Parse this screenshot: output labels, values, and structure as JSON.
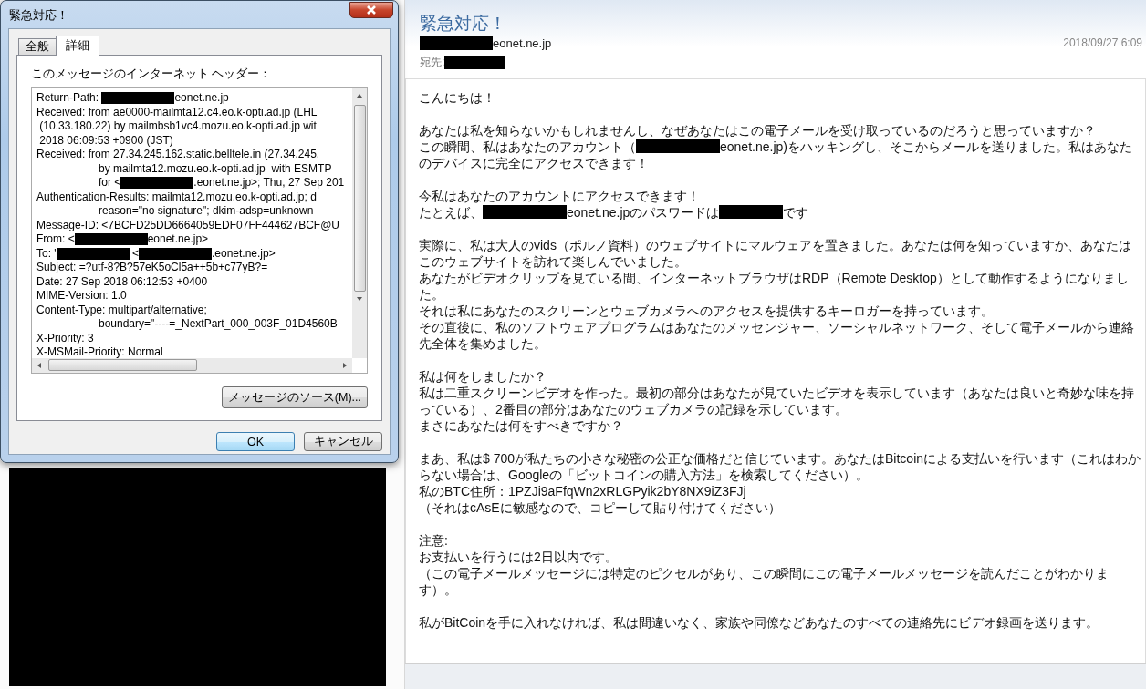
{
  "dialog": {
    "title": "緊急対応！",
    "tabs": [
      {
        "label": "全般",
        "selected": false
      },
      {
        "label": "詳細",
        "selected": true
      }
    ],
    "headers_label": "このメッセージのインターネット ヘッダー：",
    "headers": [
      {
        "indent": false,
        "segments": [
          {
            "kind": "text",
            "text": "Return-Path: "
          },
          {
            "kind": "redacted"
          },
          {
            "kind": "text",
            "text": "eonet.ne.jp"
          }
        ]
      },
      {
        "indent": false,
        "segments": [
          {
            "kind": "text",
            "text": "Received: from ae0000-mailmta12.c4.eo.k-opti.ad.jp (LHL"
          }
        ]
      },
      {
        "indent": false,
        "segments": [
          {
            "kind": "text",
            "text": " (10.33.180.22) by mailmbsb1vc4.mozu.eo.k-opti.ad.jp wit"
          }
        ]
      },
      {
        "indent": false,
        "segments": [
          {
            "kind": "text",
            "text": " 2018 06:09:53 +0900 (JST)"
          }
        ]
      },
      {
        "indent": false,
        "segments": [
          {
            "kind": "text",
            "text": "Received: from 27.34.245.162.static.belltele.in (27.34.245."
          }
        ]
      },
      {
        "indent": true,
        "segments": [
          {
            "kind": "text",
            "text": "by mailmta12.mozu.eo.k-opti.ad.jp  with ESMTP"
          }
        ]
      },
      {
        "indent": true,
        "segments": [
          {
            "kind": "text",
            "text": "for <"
          },
          {
            "kind": "redacted"
          },
          {
            "kind": "text",
            "text": ".eonet.ne.jp>; Thu, 27 Sep 201"
          }
        ]
      },
      {
        "indent": false,
        "segments": [
          {
            "kind": "text",
            "text": "Authentication-Results: mailmta12.mozu.eo.k-opti.ad.jp; d"
          }
        ]
      },
      {
        "indent": true,
        "segments": [
          {
            "kind": "text",
            "text": "reason=\"no signature\"; dkim-adsp=unknown"
          }
        ]
      },
      {
        "indent": false,
        "segments": [
          {
            "kind": "text",
            "text": "Message-ID: <7BCFD25DD6664059EDF07FF444627BCF@U"
          }
        ]
      },
      {
        "indent": false,
        "segments": [
          {
            "kind": "text",
            "text": "From: <"
          },
          {
            "kind": "redacted"
          },
          {
            "kind": "text",
            "text": "eonet.ne.jp>"
          }
        ]
      },
      {
        "indent": false,
        "segments": [
          {
            "kind": "text",
            "text": "To: '"
          },
          {
            "kind": "redacted"
          },
          {
            "kind": "text",
            "text": " <"
          },
          {
            "kind": "redacted"
          },
          {
            "kind": "text",
            "text": ".eonet.ne.jp>"
          }
        ]
      },
      {
        "indent": false,
        "segments": [
          {
            "kind": "text",
            "text": "Subject: =?utf-8?B?57eK5oCl5a++5b+c77yB?="
          }
        ]
      },
      {
        "indent": false,
        "segments": [
          {
            "kind": "text",
            "text": "Date: 27 Sep 2018 06:12:53 +0400"
          }
        ]
      },
      {
        "indent": false,
        "segments": [
          {
            "kind": "text",
            "text": "MIME-Version: 1.0"
          }
        ]
      },
      {
        "indent": false,
        "segments": [
          {
            "kind": "text",
            "text": "Content-Type: multipart/alternative;"
          }
        ]
      },
      {
        "indent": true,
        "segments": [
          {
            "kind": "text",
            "text": "boundary=\"----=_NextPart_000_003F_01D4560B"
          }
        ]
      },
      {
        "indent": false,
        "segments": [
          {
            "kind": "text",
            "text": "X-Priority: 3"
          }
        ]
      },
      {
        "indent": false,
        "segments": [
          {
            "kind": "text",
            "text": "X-MSMail-Priority: Normal"
          }
        ]
      }
    ],
    "source_button": "メッセージのソース(M)...",
    "buttons": [
      {
        "label": "OK",
        "default": true
      },
      {
        "label": "キャンセル",
        "default": false
      }
    ]
  },
  "message": {
    "subject": "緊急対応！",
    "from": [
      {
        "kind": "redacted"
      },
      {
        "kind": "text",
        "text": "eonet.ne.jp"
      }
    ],
    "date": "2018/09/27 6:09",
    "to_label": "宛先:",
    "to": [
      {
        "kind": "redacted"
      }
    ],
    "body": [
      [
        [
          {
            "kind": "text",
            "text": "こんにちは！"
          }
        ]
      ],
      [
        [
          {
            "kind": "text",
            "text": "あなたは私を知らないかもしれませんし、なぜあなたはこの電子メールを受け取っているのだろうと思っていますか？"
          }
        ],
        [
          {
            "kind": "text",
            "text": "この瞬間、私はあなたのアカウント（"
          },
          {
            "kind": "redacted"
          },
          {
            "kind": "text",
            "text": "eonet.ne.jp)をハッキングし、そこからメールを送りました。私はあなたのデバイスに完全にアクセスできます！"
          }
        ]
      ],
      [
        [
          {
            "kind": "text",
            "text": "今私はあなたのアカウントにアクセスできます！"
          }
        ],
        [
          {
            "kind": "text",
            "text": "たとえば、"
          },
          {
            "kind": "redacted"
          },
          {
            "kind": "text",
            "text": "eonet.ne.jpのパスワードは"
          },
          {
            "kind": "redacted"
          },
          {
            "kind": "text",
            "text": "です"
          }
        ]
      ],
      [
        [
          {
            "kind": "text",
            "text": "実際に、私は大人のvids（ポルノ資料）のウェブサイトにマルウェアを置きました。あなたは何を知っていますか、あなたはこのウェブサイトを訪れて楽しんでいました。"
          }
        ],
        [
          {
            "kind": "text",
            "text": "あなたがビデオクリップを見ている間、インターネットブラウザはRDP（Remote Desktop）として動作するようになりました。"
          }
        ],
        [
          {
            "kind": "text",
            "text": "それは私にあなたのスクリーンとウェブカメラへのアクセスを提供するキーロガーを持っています。"
          }
        ],
        [
          {
            "kind": "text",
            "text": "その直後に、私のソフトウェアプログラムはあなたのメッセンジャー、ソーシャルネットワーク、そして電子メールから連絡先全体を集めました。"
          }
        ]
      ],
      [
        [
          {
            "kind": "text",
            "text": "私は何をしましたか？"
          }
        ],
        [
          {
            "kind": "text",
            "text": "私は二重スクリーンビデオを作った。最初の部分はあなたが見ていたビデオを表示しています（あなたは良いと奇妙な味を持っている）、2番目の部分はあなたのウェブカメラの記録を示しています。"
          }
        ],
        [
          {
            "kind": "text",
            "text": "まさにあなたは何をすべきですか？"
          }
        ]
      ],
      [
        [
          {
            "kind": "text",
            "text": "まあ、私は$ 700が私たちの小さな秘密の公正な価格だと信じています。あなたはBitcoinによる支払いを行います（これはわからない場合は、Googleの「ビットコインの購入方法」を検索してください）。"
          }
        ],
        [
          {
            "kind": "text",
            "text": "私のBTC住所：1PZJi9aFfqWn2xRLGPyik2bY8NX9iZ3FJj"
          }
        ],
        [
          {
            "kind": "text",
            "text": "（それはcAsEに敏感なので、コピーして貼り付けてください）"
          }
        ]
      ],
      [
        [
          {
            "kind": "text",
            "text": "注意:"
          }
        ],
        [
          {
            "kind": "text",
            "text": "お支払いを行うには2日以内です。"
          }
        ],
        [
          {
            "kind": "text",
            "text": "（この電子メールメッセージには特定のピクセルがあり、この瞬間にこの電子メールメッセージを読んだことがわかります）。"
          }
        ]
      ],
      [
        [
          {
            "kind": "text",
            "text": "私がBitCoinを手に入れなければ、私は間違いなく、家族や同僚などあなたのすべての連絡先にビデオ録画を送ります。"
          }
        ]
      ]
    ]
  }
}
